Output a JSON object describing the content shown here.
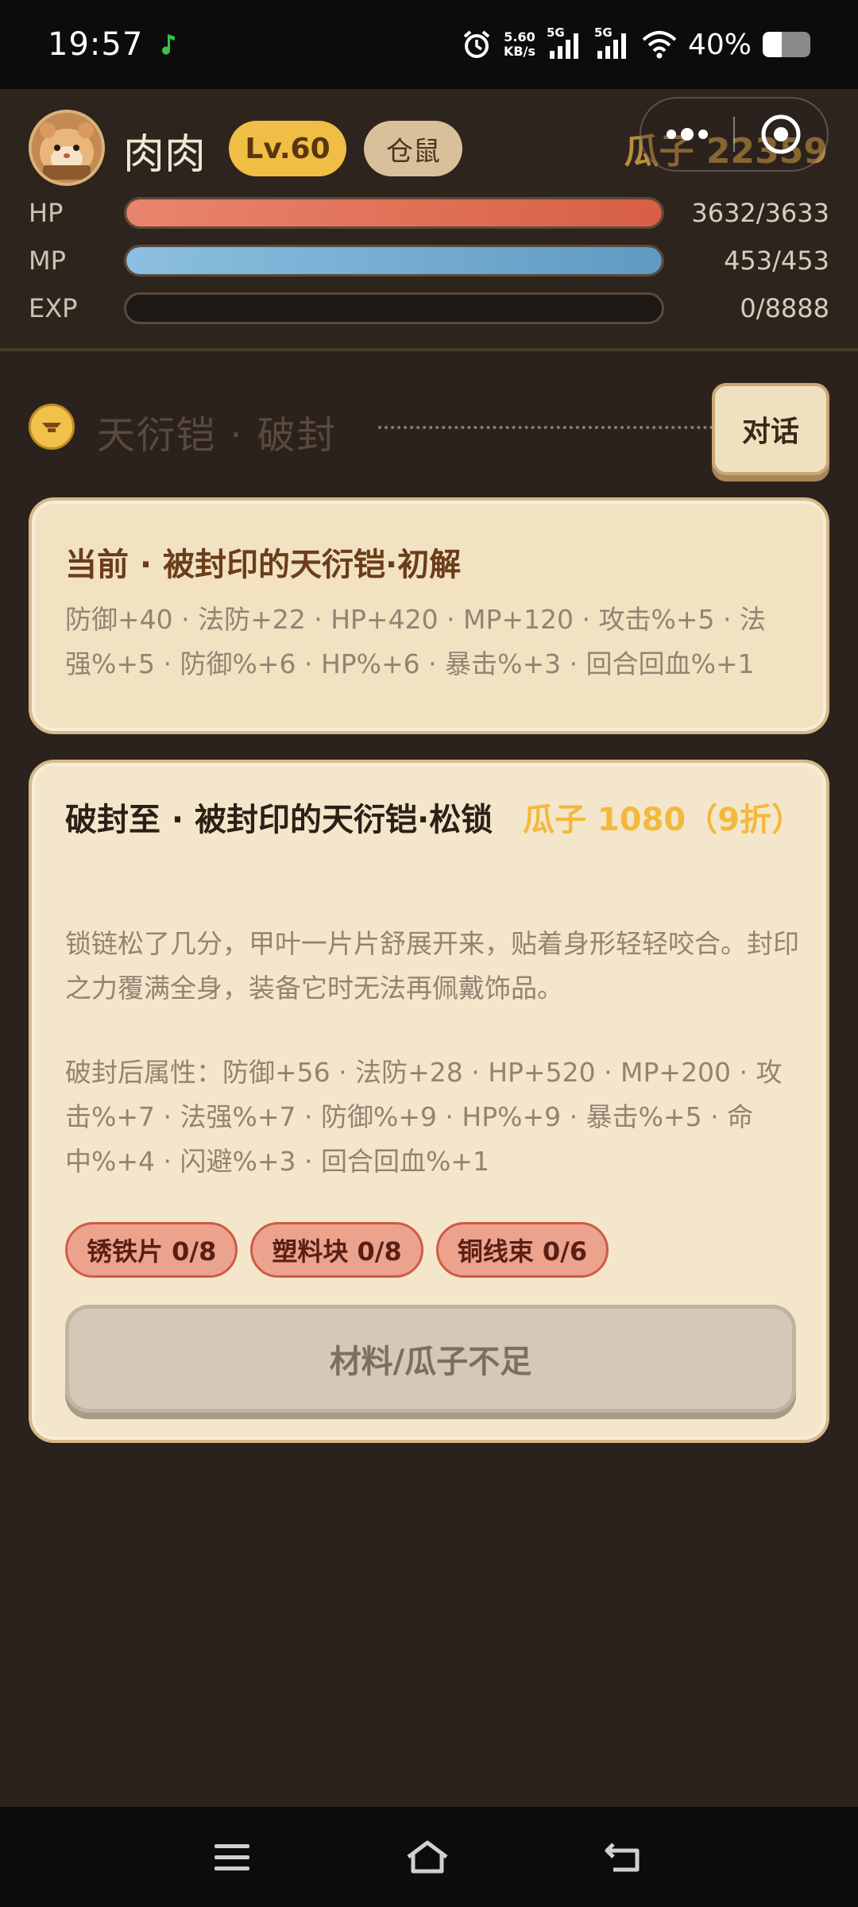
{
  "status_bar": {
    "time": "19:57",
    "net_speed_value": "5.60",
    "net_speed_unit": "KB/s",
    "sim1": "5G",
    "sim2": "5G",
    "battery": "40%",
    "battery_level": 0.4
  },
  "player": {
    "name": "肉肉",
    "level": "Lv.60",
    "race": "仓鼠",
    "currency": "瓜子 22359",
    "stats": [
      {
        "label": "HP",
        "value": "3632/3633",
        "fill": 0.9997
      },
      {
        "label": "MP",
        "value": "453/453",
        "fill": 1.0
      },
      {
        "label": "EXP",
        "value": "0/8888",
        "fill": 0.0
      }
    ]
  },
  "section": {
    "title": "天衍铠 · 破封",
    "talk_button": "对话"
  },
  "current_card": {
    "title": "当前 · 被封印的天衍铠·初解",
    "attrs": "防御+40 · 法防+22 · HP+420 · MP+120 · 攻击%+5 · 法强%+5 · 防御%+6 · HP%+6 · 暴击%+3 · 回合回血%+1"
  },
  "upgrade_card": {
    "title": "破封至 · 被封印的天衍铠·松锁",
    "price": "瓜子 1080（9折）",
    "description": "锁链松了几分，甲叶一片片舒展开来，贴着身形轻轻咬合。封印之力覆满全身，装备它时无法再佩戴饰品。",
    "attrs": "破封后属性：防御+56 · 法防+28 · HP+520 · MP+200 · 攻击%+7 · 法强%+7 · 防御%+9 · HP%+9 · 暴击%+5 · 命中%+4 · 闪避%+3 · 回合回血%+1",
    "materials": [
      "锈铁片 0/8",
      "塑料块 0/8",
      "铜线束 0/6"
    ],
    "action_button": "材料/瓜子不足"
  },
  "colors": {
    "background": "#2b221d",
    "card": "#f2e2c2",
    "level_badge": "#f0be44",
    "price": "#f3b93c",
    "hp_bar": "#d75f45",
    "mp_bar": "#5f9ac2",
    "material_chip": "#eba38e"
  },
  "icons": {
    "app_notification": "music-note-icon",
    "alarm": "alarm-icon",
    "signal": "signal-icon",
    "wifi": "wifi-icon",
    "battery": "battery-icon",
    "more": "more-dots-icon",
    "close": "target-close-icon",
    "coin": "coin-icon",
    "nav_menu": "menu-icon",
    "nav_home": "home-icon",
    "nav_back": "back-icon"
  }
}
